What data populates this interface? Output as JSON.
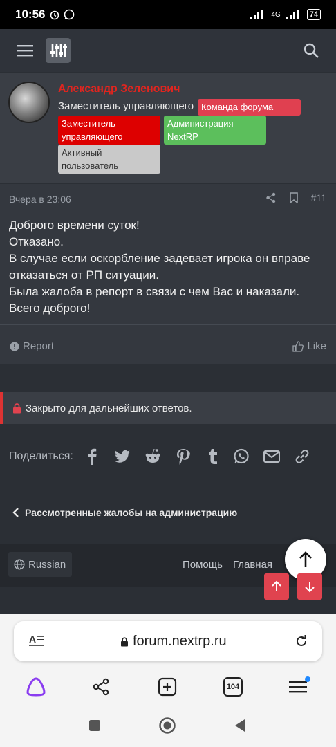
{
  "status": {
    "time": "10:56",
    "network": "4G",
    "battery": "74"
  },
  "author": {
    "name": "Александр Зеленович",
    "title": "Заместитель управляющего",
    "badges": {
      "team": "Команда форума",
      "deputy": "Заместитель управляющего",
      "admin": "Администрация NextRP",
      "active": "Активный пользователь"
    }
  },
  "post": {
    "date": "Вчера в 23:06",
    "number": "#11",
    "lines": [
      "Доброго времени суток!",
      "Отказано.",
      "В случае если оскорбление задевает игрока он вправе отказаться от РП ситуации.",
      "Была жалоба в репорт в связи с чем Вас и наказали.",
      "Всего доброго!"
    ],
    "report_label": "Report",
    "like_label": "Like"
  },
  "closed_notice": "Закрыто для дальнейших ответов.",
  "share": {
    "label": "Поделиться:"
  },
  "breadcrumb": "Рассмотренные жалобы на администрацию",
  "footer": {
    "language": "Russian",
    "help": "Помощь",
    "home": "Главная"
  },
  "browser": {
    "url": "forum.nextrp.ru",
    "tabs_count": "104"
  },
  "colors": {
    "accent_red": "#e0434f",
    "name_red": "#e0251f",
    "admin_green": "#5cbf5c"
  }
}
